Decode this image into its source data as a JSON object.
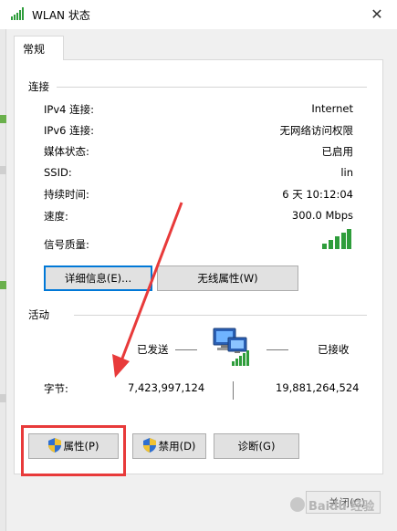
{
  "window": {
    "title": "WLAN 状态",
    "close_glyph": "✕"
  },
  "tab": {
    "label": "常规"
  },
  "connection": {
    "section_label": "连接",
    "rows": [
      {
        "label": "IPv4 连接:",
        "value": "Internet"
      },
      {
        "label": "IPv6 连接:",
        "value": "无网络访问权限"
      },
      {
        "label": "媒体状态:",
        "value": "已启用"
      },
      {
        "label": "SSID:",
        "value": "lin"
      },
      {
        "label": "持续时间:",
        "value": "6 天 10:12:04"
      },
      {
        "label": "速度:",
        "value": "300.0 Mbps"
      }
    ],
    "signal_label": "信号质量:",
    "signal_bars": 5,
    "details_button": "详细信息(E)...",
    "wireless_button": "无线属性(W)"
  },
  "activity": {
    "section_label": "活动",
    "sent_label": "已发送",
    "received_label": "已接收",
    "bytes_label": "字节:",
    "bytes_sent": "7,423,997,124",
    "bytes_received": "19,881,264,524"
  },
  "footer_buttons": {
    "properties": "属性(P)",
    "disable": "禁用(D)",
    "diagnose": "诊断(G)",
    "close_partial": "关闭(C)"
  },
  "watermark": {
    "text": "Baidu 经验"
  },
  "colors": {
    "annotation": "#e83a3a",
    "signal": "#2e9d3b",
    "accent": "#0078d7"
  },
  "icons": [
    "wlan-signal-icon",
    "close-icon",
    "signal-quality-icon",
    "network-computers-icon",
    "uac-shield-icon"
  ]
}
